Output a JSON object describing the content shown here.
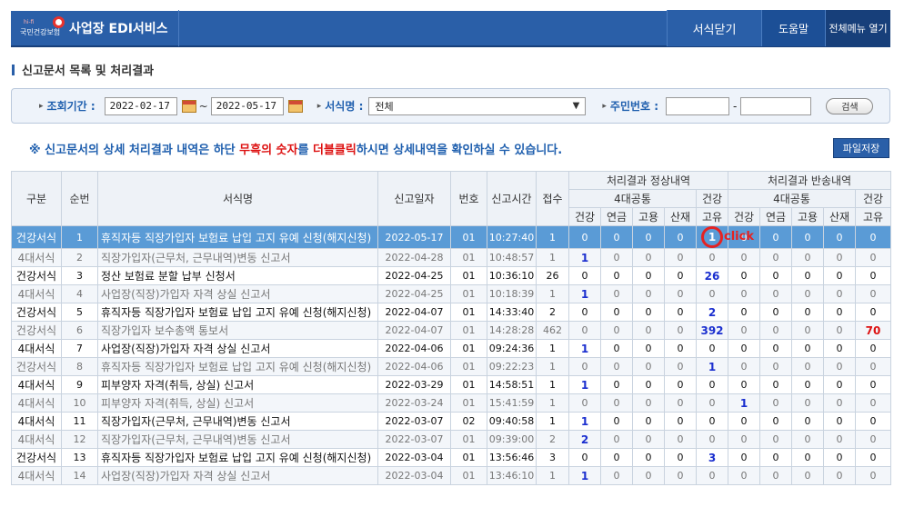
{
  "header": {
    "logo_sup": "hi-fi",
    "logo_sub": "국민건강보험",
    "title": "사업장 EDI서비스",
    "close": "서식닫기",
    "help": "도움말",
    "menu": "전체메뉴 열기"
  },
  "page_title": "신고문서 목록 및 처리결과",
  "search": {
    "period_label": "조회기간 :",
    "date_from": "2022-02-17",
    "date_sep": "~",
    "date_to": "2022-05-17",
    "form_label": "서식명 :",
    "form_value": "전체",
    "id_label": "주민번호 :",
    "id_dash": "-",
    "search_button": "검색"
  },
  "notice": {
    "part1": "※ 신고문서의 상세 처리결과 내역은 하단 ",
    "part2": "무흑의 숫자",
    "part3": "를 ",
    "part4": "더블클릭",
    "part5": "하시면 상세내역을 확인하실 수 있습니다."
  },
  "file_save_button": "파일저장",
  "table": {
    "headers": {
      "kind": "구분",
      "seq": "순번",
      "form_name": "서식명",
      "report_date": "신고일자",
      "number": "번호",
      "report_time": "신고시간",
      "receipt": "접수",
      "normal_group": "처리결과 정상내역",
      "return_group": "처리결과 반송내역",
      "four_major": "4대공통",
      "health": "건강",
      "cols": [
        "건강",
        "연금",
        "고용",
        "산재",
        "고유",
        "건강",
        "연금",
        "고용",
        "산재",
        "고유"
      ]
    },
    "rows": [
      {
        "kind": "건강서식",
        "seq": "1",
        "name": "휴직자등 직장가입자 보험료 납입 고지 유예 신청(해지신청)",
        "date": "2022-05-17",
        "no": "01",
        "time": "10:27:40",
        "recv": "1",
        "v": [
          "0",
          "0",
          "0",
          "0",
          "1",
          "0",
          "0",
          "0",
          "0",
          "0"
        ]
      },
      {
        "kind": "4대서식",
        "seq": "2",
        "name": "직장가입자(근무처, 근무내역)변동 신고서",
        "date": "2022-04-28",
        "no": "01",
        "time": "10:48:57",
        "recv": "1",
        "v": [
          "1",
          "0",
          "0",
          "0",
          "0",
          "0",
          "0",
          "0",
          "0",
          "0"
        ]
      },
      {
        "kind": "건강서식",
        "seq": "3",
        "name": "정산 보험료 분할 납부 신청서",
        "date": "2022-04-25",
        "no": "01",
        "time": "10:36:10",
        "recv": "26",
        "v": [
          "0",
          "0",
          "0",
          "0",
          "26",
          "0",
          "0",
          "0",
          "0",
          "0"
        ]
      },
      {
        "kind": "4대서식",
        "seq": "4",
        "name": "사업장(직장)가입자 자격 상실 신고서",
        "date": "2022-04-25",
        "no": "01",
        "time": "10:18:39",
        "recv": "1",
        "v": [
          "1",
          "0",
          "0",
          "0",
          "0",
          "0",
          "0",
          "0",
          "0",
          "0"
        ]
      },
      {
        "kind": "건강서식",
        "seq": "5",
        "name": "휴직자등 직장가입자 보험료 납입 고지 유예 신청(해지신청)",
        "date": "2022-04-07",
        "no": "01",
        "time": "14:33:40",
        "recv": "2",
        "v": [
          "0",
          "0",
          "0",
          "0",
          "2",
          "0",
          "0",
          "0",
          "0",
          "0"
        ]
      },
      {
        "kind": "건강서식",
        "seq": "6",
        "name": "직장가입자 보수총액 통보서",
        "date": "2022-04-07",
        "no": "01",
        "time": "14:28:28",
        "recv": "462",
        "v": [
          "0",
          "0",
          "0",
          "0",
          "392",
          "0",
          "0",
          "0",
          "0",
          "70"
        ]
      },
      {
        "kind": "4대서식",
        "seq": "7",
        "name": "사업장(직장)가입자 자격 상실 신고서",
        "date": "2022-04-06",
        "no": "01",
        "time": "09:24:36",
        "recv": "1",
        "v": [
          "1",
          "0",
          "0",
          "0",
          "0",
          "0",
          "0",
          "0",
          "0",
          "0"
        ]
      },
      {
        "kind": "건강서식",
        "seq": "8",
        "name": "휴직자등 직장가입자 보험료 납입 고지 유예 신청(해지신청)",
        "date": "2022-04-06",
        "no": "01",
        "time": "09:22:23",
        "recv": "1",
        "v": [
          "0",
          "0",
          "0",
          "0",
          "1",
          "0",
          "0",
          "0",
          "0",
          "0"
        ]
      },
      {
        "kind": "4대서식",
        "seq": "9",
        "name": "피부양자 자격(취득, 상실) 신고서",
        "date": "2022-03-29",
        "no": "01",
        "time": "14:58:51",
        "recv": "1",
        "v": [
          "1",
          "0",
          "0",
          "0",
          "0",
          "0",
          "0",
          "0",
          "0",
          "0"
        ]
      },
      {
        "kind": "4대서식",
        "seq": "10",
        "name": "피부양자 자격(취득, 상실) 신고서",
        "date": "2022-03-24",
        "no": "01",
        "time": "15:41:59",
        "recv": "1",
        "v": [
          "0",
          "0",
          "0",
          "0",
          "0",
          "1",
          "0",
          "0",
          "0",
          "0"
        ]
      },
      {
        "kind": "4대서식",
        "seq": "11",
        "name": "직장가입자(근무처, 근무내역)변동 신고서",
        "date": "2022-03-07",
        "no": "02",
        "time": "09:40:58",
        "recv": "1",
        "v": [
          "1",
          "0",
          "0",
          "0",
          "0",
          "0",
          "0",
          "0",
          "0",
          "0"
        ]
      },
      {
        "kind": "4대서식",
        "seq": "12",
        "name": "직장가입자(근무처, 근무내역)변동 신고서",
        "date": "2022-03-07",
        "no": "01",
        "time": "09:39:00",
        "recv": "2",
        "v": [
          "2",
          "0",
          "0",
          "0",
          "0",
          "0",
          "0",
          "0",
          "0",
          "0"
        ]
      },
      {
        "kind": "건강서식",
        "seq": "13",
        "name": "휴직자등 직장가입자 보험료 납입 고지 유예 신청(해지신청)",
        "date": "2022-03-04",
        "no": "01",
        "time": "13:56:46",
        "recv": "3",
        "v": [
          "0",
          "0",
          "0",
          "0",
          "3",
          "0",
          "0",
          "0",
          "0",
          "0"
        ]
      },
      {
        "kind": "4대서식",
        "seq": "14",
        "name": "사업장(직장)가입자 자격 상실 신고서",
        "date": "2022-03-04",
        "no": "01",
        "time": "13:46:10",
        "recv": "1",
        "v": [
          "1",
          "0",
          "0",
          "0",
          "0",
          "0",
          "0",
          "0",
          "0",
          "0"
        ]
      }
    ]
  },
  "click_annotation": "click",
  "colors": {
    "header_blue": "#2a5fa8",
    "selected_row": "#5a9bd6",
    "value_blue": "#1b2fcf",
    "value_red": "#d11111"
  }
}
